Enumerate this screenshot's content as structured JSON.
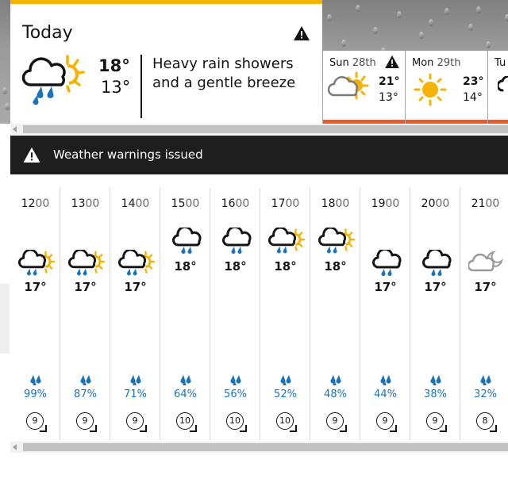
{
  "today": {
    "title": "Today",
    "max": "18°",
    "min": "13°",
    "description": "Heavy rain showers and a gentle breeze",
    "weather_icon": "heavy-rain-sun-icon",
    "warning_icon": "warning-icon"
  },
  "days": [
    {
      "name": "Sun",
      "num": "28th",
      "max": "21°",
      "min": "13°",
      "icon": "sunny-intervals-icon",
      "warning": true
    },
    {
      "name": "Mon",
      "num": "29th",
      "max": "23°",
      "min": "14°",
      "icon": "sunny-icon",
      "warning": false
    },
    {
      "name": "Tu",
      "num": "",
      "max": "",
      "min": "",
      "icon": "cloud-icon",
      "warning": false
    }
  ],
  "banner": {
    "text": "Weather warnings issued",
    "icon": "warning-icon"
  },
  "hours": [
    {
      "h": "12",
      "m": "00",
      "icon": "rain-sun-icon",
      "temp": "17°",
      "pct": "99%",
      "wind": "9"
    },
    {
      "h": "13",
      "m": "00",
      "icon": "rain-sun-icon",
      "temp": "17°",
      "pct": "87%",
      "wind": "9"
    },
    {
      "h": "14",
      "m": "00",
      "icon": "rain-sun-icon",
      "temp": "17°",
      "pct": "71%",
      "wind": "9"
    },
    {
      "h": "15",
      "m": "00",
      "icon": "rain-cloud-icon",
      "temp": "18°",
      "pct": "64%",
      "wind": "10"
    },
    {
      "h": "16",
      "m": "00",
      "icon": "rain-cloud-icon",
      "temp": "18°",
      "pct": "56%",
      "wind": "10"
    },
    {
      "h": "17",
      "m": "00",
      "icon": "rain-sun-icon",
      "temp": "18°",
      "pct": "52%",
      "wind": "10"
    },
    {
      "h": "18",
      "m": "00",
      "icon": "rain-sun-icon",
      "temp": "18°",
      "pct": "48%",
      "wind": "9"
    },
    {
      "h": "19",
      "m": "00",
      "icon": "rain-cloud-icon",
      "temp": "17°",
      "pct": "44%",
      "wind": "9"
    },
    {
      "h": "20",
      "m": "00",
      "icon": "rain-cloud-icon",
      "temp": "17°",
      "pct": "38%",
      "wind": "9"
    },
    {
      "h": "21",
      "m": "00",
      "icon": "partly-cloudy-night-icon",
      "temp": "17°",
      "pct": "32%",
      "wind": "8"
    }
  ],
  "colors": {
    "accent_yellow": "#f7b300",
    "accent_orange": "#f05a22",
    "rain_blue": "#1a73b8",
    "banner_bg": "#1e1e1e"
  }
}
